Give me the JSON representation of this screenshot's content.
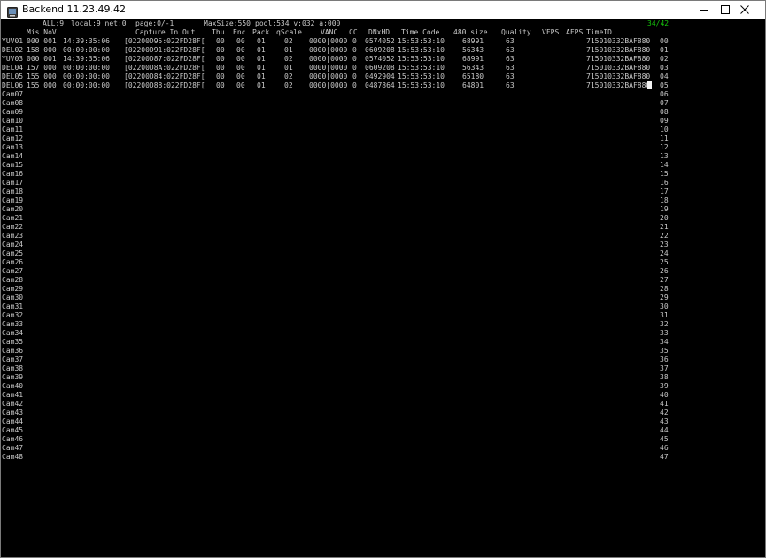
{
  "window": {
    "title": "Backend 11.23.49.42",
    "icon": "app-terminal-icon",
    "controls": [
      "minimize-icon",
      "maximize-icon",
      "close-icon"
    ]
  },
  "status": {
    "all": "ALL:9",
    "local": "local:9 net:0",
    "page": "page:0/-1",
    "maxsize": "MaxSize:550",
    "pool": "pool:534 v:032 a:000",
    "counter": "34/42",
    "counter_color": "#16c60c"
  },
  "headers": {
    "mis": "Mis NoV",
    "capture": "Capture In Out",
    "thu": "Thu",
    "enc": "Enc",
    "pack": "Pack",
    "qscale": "qScale",
    "vanc": "VANC",
    "cc": "CC",
    "dnxhd": "DNxHD",
    "timecode": "Time Code",
    "size480": "480 size",
    "quality": "Quality",
    "vfps": "VFPS",
    "afps": "AFPS",
    "timeid": "TimeID"
  },
  "rows": [
    {
      "name": "YUV01",
      "mis": "000 001",
      "time": "14:39:35:06",
      "cap": "[02200D95:022FD28F[",
      "thu": "00",
      "enc": "00",
      "pack": "01",
      "qscale": "02",
      "vanc": "0000|0000",
      "cc": "0",
      "dnx": "0574052",
      "tc": "15:53:53:10",
      "size": "68991",
      "qual": "63",
      "timeid": "715010332BAF880",
      "idx": "00"
    },
    {
      "name": "DEL02",
      "mis": "158 000",
      "time": "00:00:00:00",
      "cap": "[02200D91:022FD28F[",
      "thu": "00",
      "enc": "00",
      "pack": "01",
      "qscale": "01",
      "vanc": "0000|0000",
      "cc": "0",
      "dnx": "0609208",
      "tc": "15:53:53:10",
      "size": "56343",
      "qual": "63",
      "timeid": "715010332BAF880",
      "idx": "01"
    },
    {
      "name": "YUV03",
      "mis": "000 001",
      "time": "14:39:35:06",
      "cap": "[02200D87:022FD28F[",
      "thu": "00",
      "enc": "00",
      "pack": "01",
      "qscale": "02",
      "vanc": "0000|0000",
      "cc": "0",
      "dnx": "0574052",
      "tc": "15:53:53:10",
      "size": "68991",
      "qual": "63",
      "timeid": "715010332BAF880",
      "idx": "02"
    },
    {
      "name": "DEL04",
      "mis": "157 000",
      "time": "00:00:00:00",
      "cap": "[02200D8A:022FD28F[",
      "thu": "00",
      "enc": "00",
      "pack": "01",
      "qscale": "01",
      "vanc": "0000|0000",
      "cc": "0",
      "dnx": "0609208",
      "tc": "15:53:53:10",
      "size": "56343",
      "qual": "63",
      "timeid": "715010332BAF880",
      "idx": "03"
    },
    {
      "name": "DEL05",
      "mis": "155 000",
      "time": "00:00:00:00",
      "cap": "[02200D84:022FD28F[",
      "thu": "00",
      "enc": "00",
      "pack": "01",
      "qscale": "02",
      "vanc": "0000|0000",
      "cc": "0",
      "dnx": "0492904",
      "tc": "15:53:53:10",
      "size": "65180",
      "qual": "63",
      "timeid": "715010332BAF880",
      "idx": "04"
    },
    {
      "name": "DEL06",
      "mis": "155 000",
      "time": "00:00:00:00",
      "cap": "[02200D88:022FD28F[",
      "thu": "00",
      "enc": "00",
      "pack": "01",
      "qscale": "02",
      "vanc": "0000|0000",
      "cc": "0",
      "dnx": "0487864",
      "tc": "15:53:53:10",
      "size": "64801",
      "qual": "63",
      "timeid": "715010332BAF880",
      "idx": "05"
    }
  ],
  "cams": [
    {
      "name": "Cam07",
      "idx": "06"
    },
    {
      "name": "Cam08",
      "idx": "07"
    },
    {
      "name": "Cam09",
      "idx": "08"
    },
    {
      "name": "Cam10",
      "idx": "09"
    },
    {
      "name": "Cam11",
      "idx": "10"
    },
    {
      "name": "Cam12",
      "idx": "11"
    },
    {
      "name": "Cam13",
      "idx": "12"
    },
    {
      "name": "Cam14",
      "idx": "13"
    },
    {
      "name": "Cam15",
      "idx": "14"
    },
    {
      "name": "Cam16",
      "idx": "15"
    },
    {
      "name": "Cam17",
      "idx": "16"
    },
    {
      "name": "Cam18",
      "idx": "17"
    },
    {
      "name": "Cam19",
      "idx": "18"
    },
    {
      "name": "Cam20",
      "idx": "19"
    },
    {
      "name": "Cam21",
      "idx": "20"
    },
    {
      "name": "Cam22",
      "idx": "21"
    },
    {
      "name": "Cam23",
      "idx": "22"
    },
    {
      "name": "Cam24",
      "idx": "23"
    },
    {
      "name": "Cam25",
      "idx": "24"
    },
    {
      "name": "Cam26",
      "idx": "25"
    },
    {
      "name": "Cam27",
      "idx": "26"
    },
    {
      "name": "Cam28",
      "idx": "27"
    },
    {
      "name": "Cam29",
      "idx": "28"
    },
    {
      "name": "Cam30",
      "idx": "29"
    },
    {
      "name": "Cam31",
      "idx": "30"
    },
    {
      "name": "Cam32",
      "idx": "31"
    },
    {
      "name": "Cam33",
      "idx": "32"
    },
    {
      "name": "Cam34",
      "idx": "33"
    },
    {
      "name": "Cam35",
      "idx": "34"
    },
    {
      "name": "Cam36",
      "idx": "35"
    },
    {
      "name": "Cam37",
      "idx": "36"
    },
    {
      "name": "Cam38",
      "idx": "37"
    },
    {
      "name": "Cam39",
      "idx": "38"
    },
    {
      "name": "Cam40",
      "idx": "39"
    },
    {
      "name": "Cam41",
      "idx": "40"
    },
    {
      "name": "Cam42",
      "idx": "41"
    },
    {
      "name": "Cam43",
      "idx": "42"
    },
    {
      "name": "Cam44",
      "idx": "43"
    },
    {
      "name": "Cam45",
      "idx": "44"
    },
    {
      "name": "Cam46",
      "idx": "45"
    },
    {
      "name": "Cam47",
      "idx": "46"
    },
    {
      "name": "Cam48",
      "idx": "47"
    }
  ]
}
